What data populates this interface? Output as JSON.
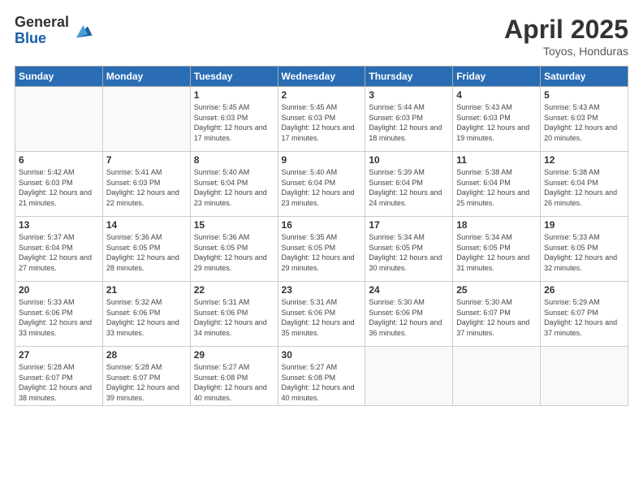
{
  "header": {
    "logo_general": "General",
    "logo_blue": "Blue",
    "month_title": "April 2025",
    "location": "Toyos, Honduras"
  },
  "days_of_week": [
    "Sunday",
    "Monday",
    "Tuesday",
    "Wednesday",
    "Thursday",
    "Friday",
    "Saturday"
  ],
  "weeks": [
    [
      {
        "day": "",
        "info": ""
      },
      {
        "day": "",
        "info": ""
      },
      {
        "day": "1",
        "info": "Sunrise: 5:45 AM\nSunset: 6:03 PM\nDaylight: 12 hours and 17 minutes."
      },
      {
        "day": "2",
        "info": "Sunrise: 5:45 AM\nSunset: 6:03 PM\nDaylight: 12 hours and 17 minutes."
      },
      {
        "day": "3",
        "info": "Sunrise: 5:44 AM\nSunset: 6:03 PM\nDaylight: 12 hours and 18 minutes."
      },
      {
        "day": "4",
        "info": "Sunrise: 5:43 AM\nSunset: 6:03 PM\nDaylight: 12 hours and 19 minutes."
      },
      {
        "day": "5",
        "info": "Sunrise: 5:43 AM\nSunset: 6:03 PM\nDaylight: 12 hours and 20 minutes."
      }
    ],
    [
      {
        "day": "6",
        "info": "Sunrise: 5:42 AM\nSunset: 6:03 PM\nDaylight: 12 hours and 21 minutes."
      },
      {
        "day": "7",
        "info": "Sunrise: 5:41 AM\nSunset: 6:03 PM\nDaylight: 12 hours and 22 minutes."
      },
      {
        "day": "8",
        "info": "Sunrise: 5:40 AM\nSunset: 6:04 PM\nDaylight: 12 hours and 23 minutes."
      },
      {
        "day": "9",
        "info": "Sunrise: 5:40 AM\nSunset: 6:04 PM\nDaylight: 12 hours and 23 minutes."
      },
      {
        "day": "10",
        "info": "Sunrise: 5:39 AM\nSunset: 6:04 PM\nDaylight: 12 hours and 24 minutes."
      },
      {
        "day": "11",
        "info": "Sunrise: 5:38 AM\nSunset: 6:04 PM\nDaylight: 12 hours and 25 minutes."
      },
      {
        "day": "12",
        "info": "Sunrise: 5:38 AM\nSunset: 6:04 PM\nDaylight: 12 hours and 26 minutes."
      }
    ],
    [
      {
        "day": "13",
        "info": "Sunrise: 5:37 AM\nSunset: 6:04 PM\nDaylight: 12 hours and 27 minutes."
      },
      {
        "day": "14",
        "info": "Sunrise: 5:36 AM\nSunset: 6:05 PM\nDaylight: 12 hours and 28 minutes."
      },
      {
        "day": "15",
        "info": "Sunrise: 5:36 AM\nSunset: 6:05 PM\nDaylight: 12 hours and 29 minutes."
      },
      {
        "day": "16",
        "info": "Sunrise: 5:35 AM\nSunset: 6:05 PM\nDaylight: 12 hours and 29 minutes."
      },
      {
        "day": "17",
        "info": "Sunrise: 5:34 AM\nSunset: 6:05 PM\nDaylight: 12 hours and 30 minutes."
      },
      {
        "day": "18",
        "info": "Sunrise: 5:34 AM\nSunset: 6:05 PM\nDaylight: 12 hours and 31 minutes."
      },
      {
        "day": "19",
        "info": "Sunrise: 5:33 AM\nSunset: 6:05 PM\nDaylight: 12 hours and 32 minutes."
      }
    ],
    [
      {
        "day": "20",
        "info": "Sunrise: 5:33 AM\nSunset: 6:06 PM\nDaylight: 12 hours and 33 minutes."
      },
      {
        "day": "21",
        "info": "Sunrise: 5:32 AM\nSunset: 6:06 PM\nDaylight: 12 hours and 33 minutes."
      },
      {
        "day": "22",
        "info": "Sunrise: 5:31 AM\nSunset: 6:06 PM\nDaylight: 12 hours and 34 minutes."
      },
      {
        "day": "23",
        "info": "Sunrise: 5:31 AM\nSunset: 6:06 PM\nDaylight: 12 hours and 35 minutes."
      },
      {
        "day": "24",
        "info": "Sunrise: 5:30 AM\nSunset: 6:06 PM\nDaylight: 12 hours and 36 minutes."
      },
      {
        "day": "25",
        "info": "Sunrise: 5:30 AM\nSunset: 6:07 PM\nDaylight: 12 hours and 37 minutes."
      },
      {
        "day": "26",
        "info": "Sunrise: 5:29 AM\nSunset: 6:07 PM\nDaylight: 12 hours and 37 minutes."
      }
    ],
    [
      {
        "day": "27",
        "info": "Sunrise: 5:28 AM\nSunset: 6:07 PM\nDaylight: 12 hours and 38 minutes."
      },
      {
        "day": "28",
        "info": "Sunrise: 5:28 AM\nSunset: 6:07 PM\nDaylight: 12 hours and 39 minutes."
      },
      {
        "day": "29",
        "info": "Sunrise: 5:27 AM\nSunset: 6:08 PM\nDaylight: 12 hours and 40 minutes."
      },
      {
        "day": "30",
        "info": "Sunrise: 5:27 AM\nSunset: 6:08 PM\nDaylight: 12 hours and 40 minutes."
      },
      {
        "day": "",
        "info": ""
      },
      {
        "day": "",
        "info": ""
      },
      {
        "day": "",
        "info": ""
      }
    ]
  ]
}
